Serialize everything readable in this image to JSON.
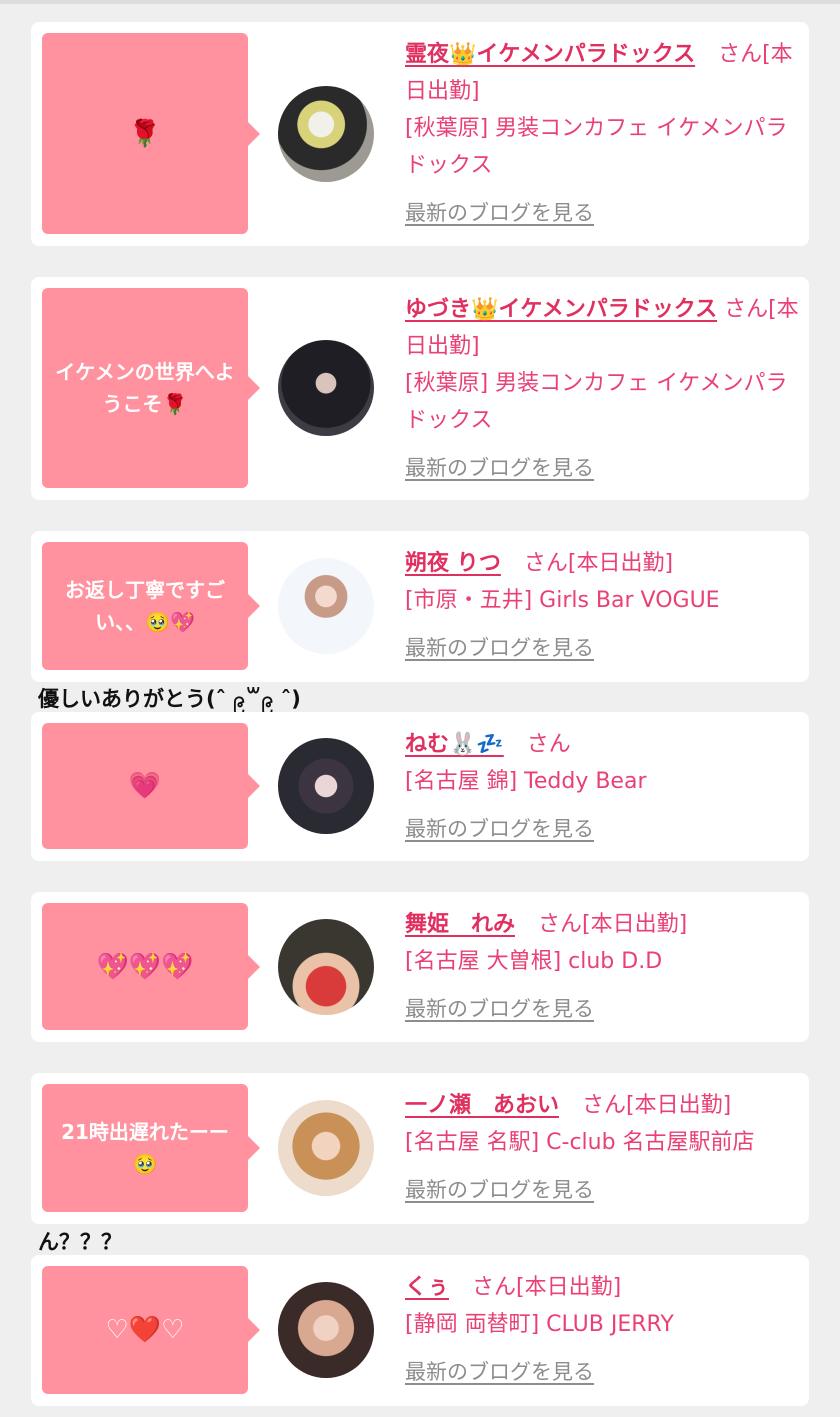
{
  "blog_link_label": "最新のブログを見る",
  "cards": [
    {
      "message": "🌹",
      "name": "霊夜👑イケメンパラドックス",
      "suffix": "さん",
      "shift": "[本日出勤]",
      "shop": "[秋葉原] 男装コンカフェ イケメンパラドックス"
    },
    {
      "message": "イケメンの世界へようこそ🌹",
      "name": "ゆづき👑イケメンパラドックス",
      "suffix": "さん",
      "shift": "[本日出勤]",
      "shop": "[秋葉原] 男装コンカフェ イケメンパラドックス"
    },
    {
      "message": "お返し丁寧ですごい、、🥹💖",
      "name": "朔夜 りつ",
      "suffix": "さん",
      "shift": "[本日出勤]",
      "shop": "[市原・五井] Girls Bar VOGUE"
    },
    {
      "message": "💗",
      "name": "ねむ🐰💤",
      "suffix": "さん",
      "shift": "",
      "shop": "[名古屋 錦] Teddy Bear"
    },
    {
      "message": "💖💖💖",
      "name": "舞姫　れみ",
      "suffix": "さん",
      "shift": "[本日出勤]",
      "shop": "[名古屋 大曽根] club D.D"
    },
    {
      "message": "21時出遅れたーー🥹",
      "name": "一ノ瀬　あおい",
      "suffix": "さん",
      "shift": "[本日出勤]",
      "shop": "[名古屋 名駅] C-club 名古屋駅前店"
    },
    {
      "message": "♡❤️♡",
      "name": "くぅ",
      "suffix": "さん",
      "shift": "[本日出勤]",
      "shop": "[静岡 両替町] CLUB JERRY"
    }
  ],
  "captions": {
    "after_card_3": "優しいありがとう(ˆ ၉꒳၉ ˆ)",
    "after_card_6": "ん？？？"
  }
}
